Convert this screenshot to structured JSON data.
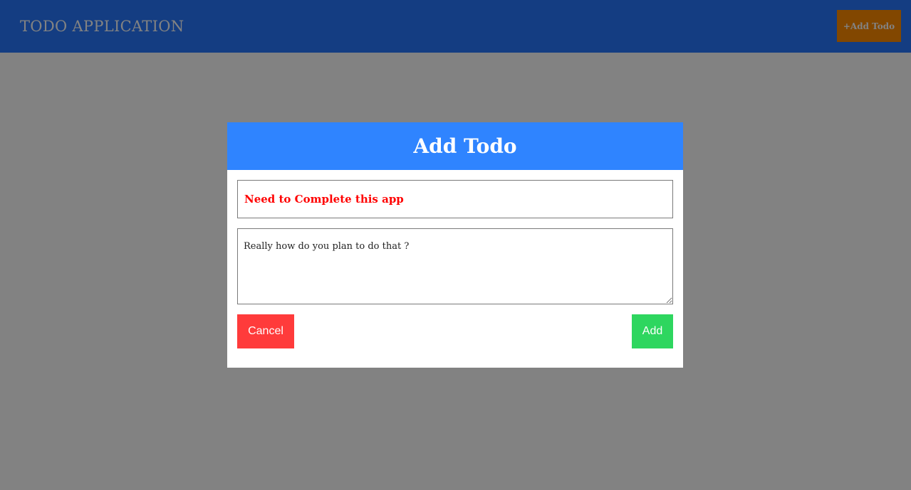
{
  "header": {
    "title": "TODO APPLICATION",
    "add_button_label": "+Add Todo"
  },
  "modal": {
    "title": "Add Todo",
    "title_input_value": "Need to Complete this app",
    "description_value": "Really how do you plan to do that ?",
    "cancel_label": "Cancel",
    "add_label": "Add"
  },
  "colors": {
    "header_bg": "#2879ff",
    "header_button_bg": "#ff8c00",
    "modal_header_bg": "#2f84ff",
    "title_text": "#ff0000",
    "cancel_bg": "#ff3b3b",
    "add_bg": "#2ed65f",
    "overlay": "rgba(0,0,0,0.49)"
  }
}
